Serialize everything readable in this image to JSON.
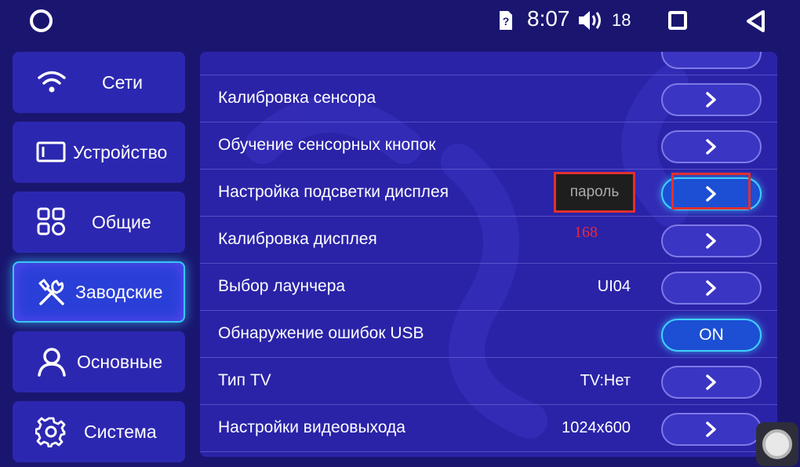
{
  "status_bar": {
    "time": "8:07",
    "volume": "18",
    "icons": [
      "home-circle-icon",
      "sim-alert-icon",
      "volume-icon",
      "recents-square-icon",
      "back-triangle-icon"
    ]
  },
  "sidebar": {
    "items": [
      {
        "label": "Сети",
        "icon": "wifi-icon",
        "active": false
      },
      {
        "label": "Устройство",
        "icon": "screen-icon",
        "active": false
      },
      {
        "label": "Общие",
        "icon": "grid-icon",
        "active": false
      },
      {
        "label": "Заводские",
        "icon": "tools-icon",
        "active": true
      },
      {
        "label": "Основные",
        "icon": "user-icon",
        "active": false
      },
      {
        "label": "Система",
        "icon": "gear-icon",
        "active": false
      }
    ]
  },
  "settings": {
    "rows": [
      {
        "label": "Калибровка сенсора",
        "value": "",
        "button": "chevron"
      },
      {
        "label": "Обучение сенсорных кнопок",
        "value": "",
        "button": "chevron"
      },
      {
        "label": "Настройка подсветки дисплея",
        "value": "",
        "button": "chevron"
      },
      {
        "label": "Калибровка дисплея",
        "value": "",
        "button": "chevron"
      },
      {
        "label": "Выбор лаунчера",
        "value": "UI04",
        "button": "chevron"
      },
      {
        "label": "Обнаружение ошибок USB",
        "value": "",
        "button": "ON"
      },
      {
        "label": "Тип TV",
        "value": "TV:Нет",
        "button": "chevron"
      },
      {
        "label": "Настройки видеовыхода",
        "value": "1024x600",
        "button": "chevron"
      }
    ]
  },
  "overlay": {
    "password_label": "пароль",
    "password_hint": "168"
  },
  "colors": {
    "background": "#1a1670",
    "panel": "#2a23a8",
    "sidebar_item": "#2c27b0",
    "accent": "#39c5ff",
    "highlight_red": "#e03030"
  }
}
